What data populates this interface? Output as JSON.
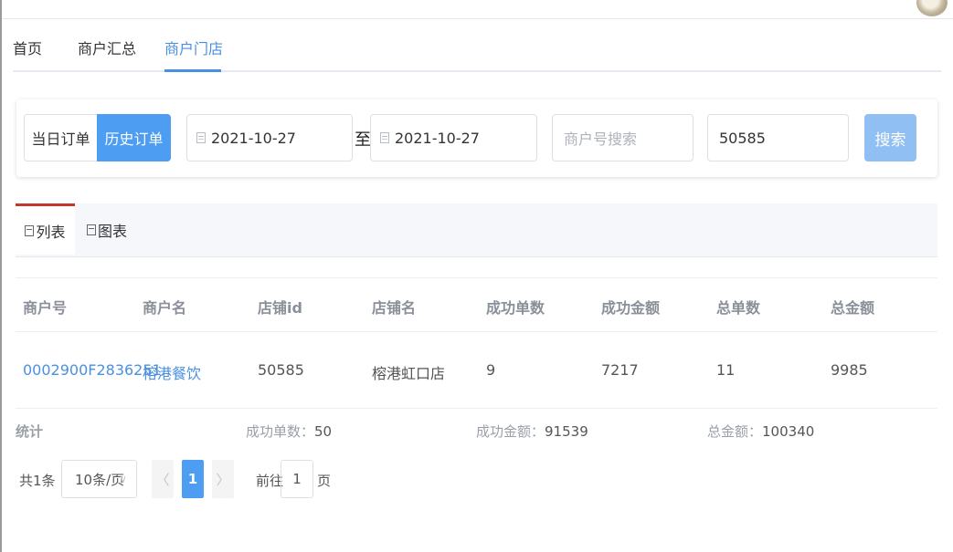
{
  "nav": {
    "items": [
      {
        "label": "首页"
      },
      {
        "label": "商户汇总"
      },
      {
        "label": "商户门店"
      }
    ],
    "active_index": 2
  },
  "filter": {
    "order_tabs": [
      "当日订单",
      "历史订单"
    ],
    "active_order_tab": "历史订单",
    "start_date": "2021-10-27",
    "to_label": "至",
    "end_date": "2021-10-27",
    "merchant_search_placeholder": "商户号搜索",
    "store_search_value": "50585",
    "search_button": "搜索"
  },
  "view_tabs": [
    {
      "label": "列表",
      "icon": "list-icon"
    },
    {
      "label": "图表",
      "icon": "chart-icon"
    }
  ],
  "table": {
    "headers": [
      "商户号",
      "商户名",
      "店铺id",
      "店铺名",
      "成功单数",
      "成功金额",
      "总单数",
      "总金额"
    ],
    "rows": [
      [
        "0002900F2836251",
        "榕港餐饮",
        "50585",
        "榕港虹口店",
        "9",
        "7217",
        "11",
        "9985"
      ]
    ]
  },
  "stats": {
    "title": "统计",
    "success_count_label": "成功单数：",
    "success_count": "50",
    "success_amount_label": "成功金额：",
    "success_amount": "91539",
    "total_amount_label": "总金额：",
    "total_amount": "100340"
  },
  "pagination": {
    "total": "共1条",
    "page_size": "10条/页",
    "current_page": "1",
    "goto_label": "前往",
    "goto_value": "1",
    "page_unit": "页"
  },
  "colors": {
    "accent": "#4d9df2",
    "link": "#4a90e2",
    "active_tab_top": "#c0392b"
  }
}
